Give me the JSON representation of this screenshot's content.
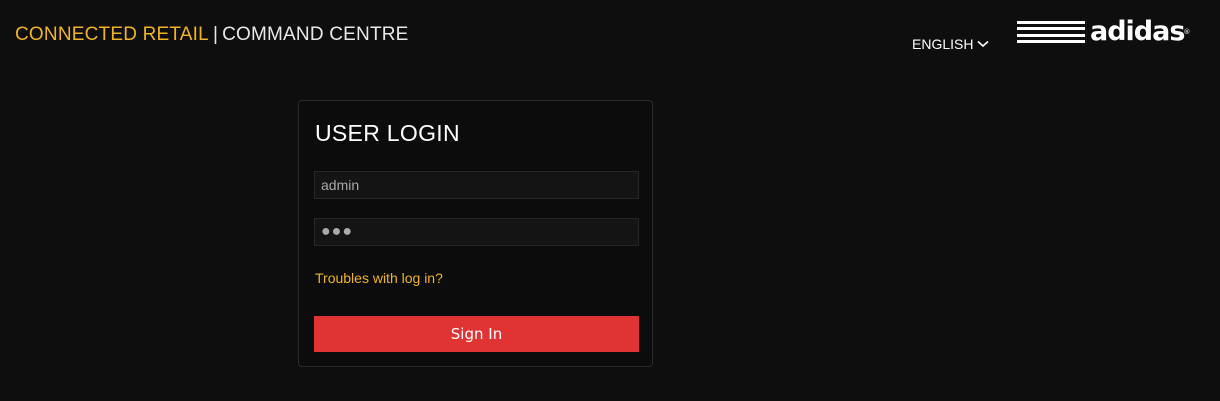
{
  "header": {
    "brand_primary": "CONNECTED RETAIL",
    "brand_separator": "|",
    "brand_secondary": "COMMAND CENTRE",
    "language": "ENGLISH",
    "logo_text": "adidas",
    "logo_reg_mark": "®"
  },
  "login": {
    "title": "USER LOGIN",
    "username_value": "admin",
    "password_value": "●●●",
    "trouble_link": "Troubles with log in?",
    "signin_label": "Sign In"
  },
  "colors": {
    "background": "#0e0e0e",
    "accent_yellow": "#f0b323",
    "button_red": "#e03333"
  },
  "icons": {
    "language_dropdown": "chevron-down-icon",
    "logo": "three-stripes-logo-icon"
  }
}
